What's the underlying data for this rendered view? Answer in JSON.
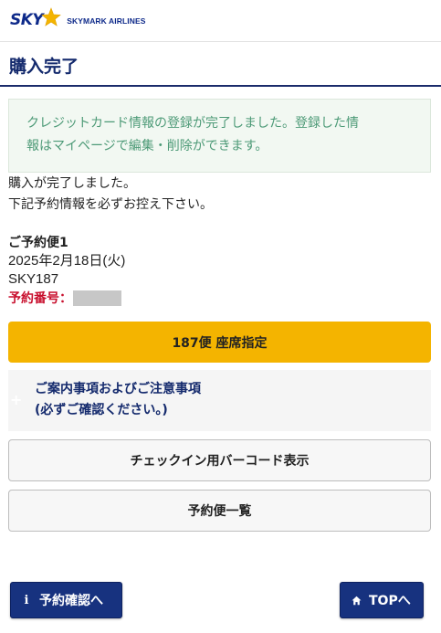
{
  "header": {
    "logo_text": "SKY",
    "airline_name": "SKYMARK AIRLINES"
  },
  "page": {
    "title": "購入完了"
  },
  "notice": {
    "line1": "クレジットカード情報の登録が完了しました。登録した情",
    "line2": "報はマイページで編集・削除ができます。"
  },
  "completion": {
    "line1": "購入が完了しました。",
    "line2": "下記予約情報を必ずお控え下さい。"
  },
  "flight": {
    "heading": "ご予約便1",
    "date": "2025年2月18日(火)",
    "flight_number": "SKY187",
    "reservation_label": "予約番号："
  },
  "buttons": {
    "seat_select": "187便 座席指定",
    "checkin_barcode": "チェックイン用バーコード表示",
    "reservation_list": "予約便一覧",
    "reservation_confirm": "予約確認へ",
    "top": "TOPへ"
  },
  "info_box": {
    "line1": "ご案内事項およびご注意事項",
    "line2": "(必ずご確認ください。)"
  },
  "colors": {
    "brand_navy": "#142a6d",
    "button_navy": "#17327f",
    "seat_button_yellow": "#f4b400",
    "notice_text_green": "#4d9a77",
    "reservation_red": "#c8102e"
  },
  "icons": {
    "logo_star": "star-icon",
    "info_box_toggle": "plus-icon",
    "reserve_button": "info-icon",
    "top_button": "home-icon"
  }
}
